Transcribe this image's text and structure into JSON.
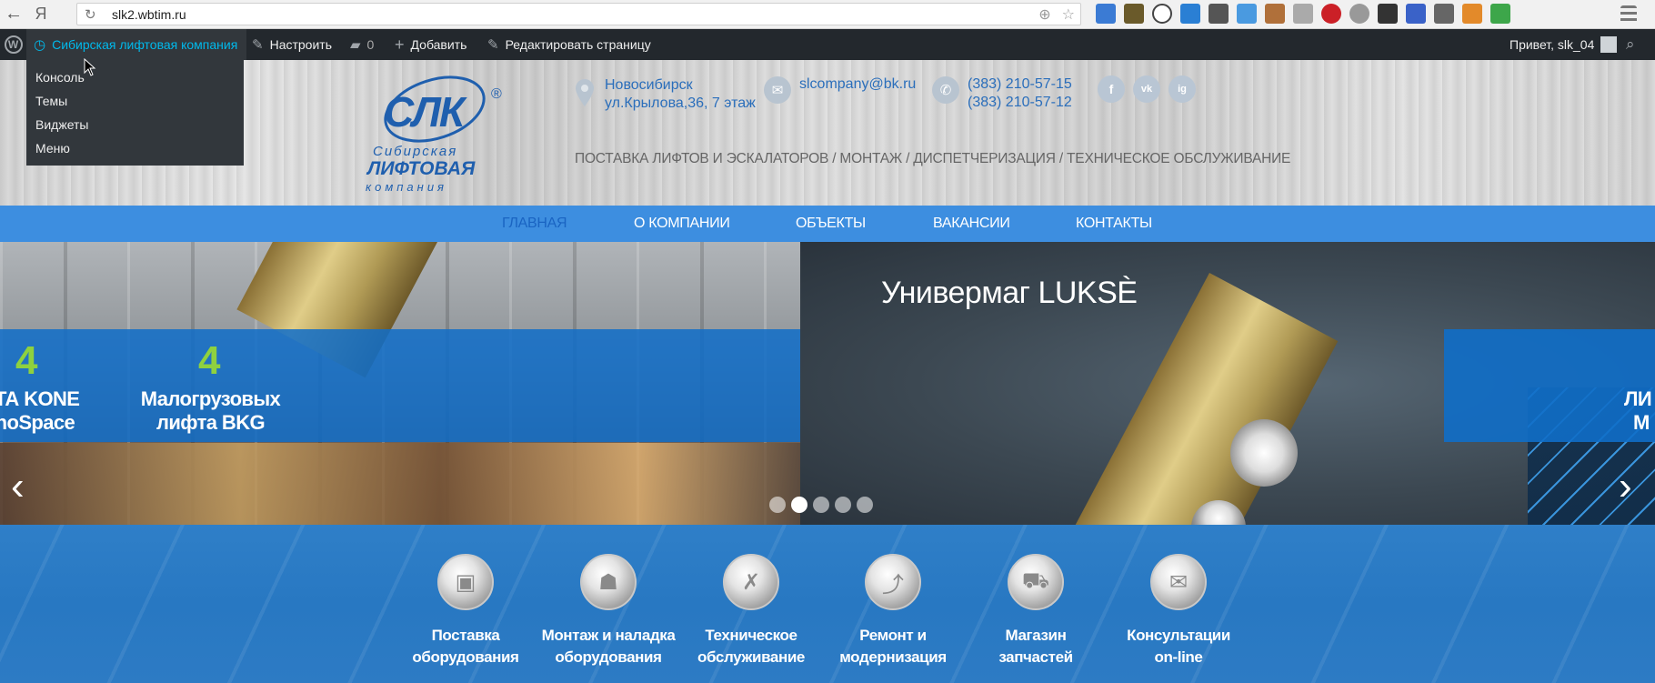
{
  "browser": {
    "url": "slk2.wbtim.ru",
    "back_icon": "←",
    "yandex_icon": "Я"
  },
  "adminbar": {
    "site_name": "Сибирская лифтовая компания",
    "customize": "Настроить",
    "comments_count": "0",
    "add_new": "Добавить",
    "edit_page": "Редактировать страницу",
    "greeting": "Привет, slk_04",
    "site_menu": [
      "Консоль",
      "Темы",
      "Виджеты",
      "Меню"
    ]
  },
  "header": {
    "logo_letters": "СЛК",
    "logo_line1": "Сибирская",
    "logo_line2": "ЛИФТОВАЯ",
    "logo_line3": "компания",
    "logo_reg": "®",
    "city": "Новосибирск",
    "address": "ул.Крылова,36, 7 этаж",
    "email": "slcompany@bk.ru",
    "phone1": "(383) 210-57-15",
    "phone2": "(383) 210-57-12",
    "social": [
      "f",
      "vk",
      "ig"
    ],
    "tagline": "ПОСТАВКА ЛИФТОВ И ЭСКАЛАТОРОВ / МОНТАЖ / ДИСПЕТЧЕРИЗАЦИЯ / ТЕХНИЧЕСКОЕ ОБСЛУЖИВАНИЕ"
  },
  "nav": {
    "items": [
      "ГЛАВНАЯ",
      "О КОМПАНИИ",
      "ОБЪЕКТЫ",
      "ВАКАНСИИ",
      "КОНТАКТЫ"
    ],
    "active": "ГЛАВНАЯ"
  },
  "slider": {
    "title": "Универмаг LUKSÈ",
    "stats": [
      {
        "number": "4",
        "line1": "ЛИФТА KONE",
        "line2": "MonoSpace",
        "shown1": "ФТА KONE",
        "shown2": "onoSpace"
      },
      {
        "number": "4",
        "line1": "Малогрузовых",
        "line2": "лифта BKG"
      }
    ],
    "right_partial": [
      "ЛИ",
      "M"
    ],
    "dots": 5,
    "active_dot": 2,
    "prev_icon": "‹",
    "next_icon": "›"
  },
  "services": [
    {
      "line1": "Поставка",
      "line2": "оборудования",
      "icon": "elevator-icon"
    },
    {
      "line1": "Монтаж и наладка",
      "line2": "оборудования",
      "icon": "worker-icon"
    },
    {
      "line1": "Техническое",
      "line2": "обслуживание",
      "icon": "wrench-icon"
    },
    {
      "line1": "Ремонт и",
      "line2": "модернизация",
      "icon": "escalator-icon"
    },
    {
      "line1": "Магазин",
      "line2": "запчастей",
      "icon": "cart-icon"
    },
    {
      "line1": "Консультации",
      "line2": "on-line",
      "icon": "mail-icon"
    }
  ],
  "colors": {
    "accent": "#3d8ee0",
    "brand_blue": "#1f5fae",
    "stat_green": "#8ed13f",
    "adminbar": "#23282d"
  }
}
